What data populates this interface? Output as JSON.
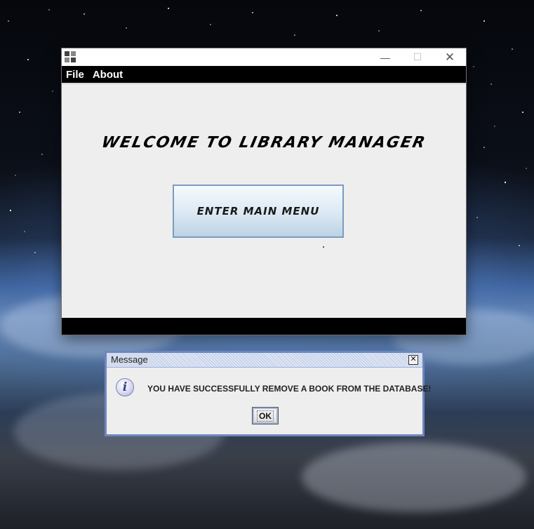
{
  "main_window": {
    "menu": [
      "File",
      "About"
    ],
    "welcome_text": "WELCOME TO LIBRARY MANAGER",
    "main_menu_button": "ENTER MAIN MENU"
  },
  "dialog": {
    "title": "Message",
    "message": "YOU HAVE SUCCESSFULLY REMOVE A BOOK FROM THE DATABASE!",
    "ok_label": "OK",
    "close_glyph": "✕",
    "icon": "info-icon"
  },
  "window_controls": {
    "minimize": "—",
    "maximize": "☐",
    "close": "✕"
  }
}
